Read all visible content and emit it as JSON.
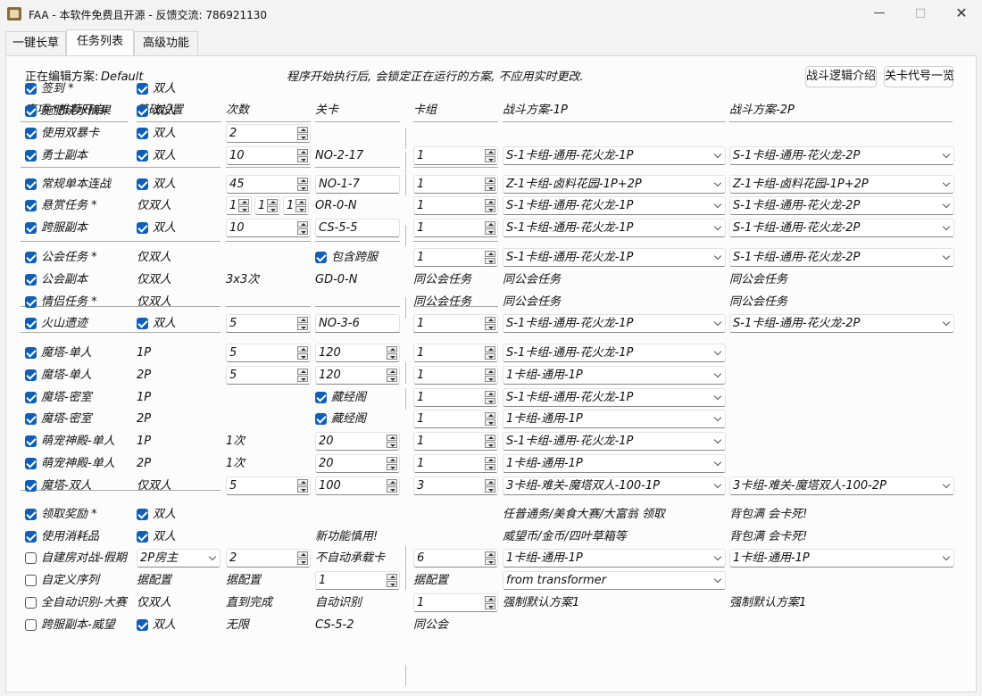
{
  "window": {
    "title": "FAA - 本软件免费且开源 - 反馈交流: 786921130"
  },
  "tabs": [
    "一键长草",
    "任务列表",
    "高级功能"
  ],
  "editing": {
    "label": "正在编辑方案:",
    "scheme": "Default",
    "notice": "程序开始执行后, 会锁定正在运行的方案, 不应用实时更改.",
    "btn_logic": "战斗逻辑介绍",
    "btn_codes": "关卡代号一览"
  },
  "columns": [
    "事项 *推荐开启",
    "基础设置",
    "次数",
    "关卡",
    "卡组",
    "战斗方案-1P",
    "战斗方案-2P"
  ],
  "rows": [
    {
      "name": "签到 *",
      "base": "双人"
    },
    {
      "name": "施肥浇水摘果",
      "base": "双人"
    },
    {
      "name": "使用双暴卡",
      "base": "双人",
      "count": "2"
    },
    {
      "name": "勇士副本",
      "base": "双人",
      "count": "10",
      "stage": "NO-2-17",
      "deck": "1",
      "p1": "S-1卡组-通用-花火龙-1P",
      "p2": "S-1卡组-通用-花火龙-2P"
    },
    {
      "name": "常规单本连战",
      "base": "双人",
      "count": "45",
      "stage": "NO-1-7",
      "deck": "1",
      "p1": "Z-1卡组-卤料花园-1P+2P",
      "p2": "Z-1卡组-卤料花园-1P+2P"
    },
    {
      "name": "悬赏任务 *",
      "base": "仅双人",
      "counts": [
        "1",
        "1",
        "1"
      ],
      "stage": "OR-0-N",
      "deck": "1",
      "p1": "S-1卡组-通用-花火龙-1P",
      "p2": "S-1卡组-通用-花火龙-2P"
    },
    {
      "name": "跨服副本",
      "base": "双人",
      "count": "10",
      "stage": "CS-5-5",
      "deck": "1",
      "p1": "S-1卡组-通用-花火龙-1P",
      "p2": "S-1卡组-通用-花火龙-2P"
    },
    {
      "name": "公会任务 *",
      "base": "仅双人",
      "stage": "包含跨服",
      "deck": "1",
      "p1": "S-1卡组-通用-花火龙-1P",
      "p2": "S-1卡组-通用-花火龙-2P"
    },
    {
      "name": "公会副本",
      "base": "仅双人",
      "count": "3x3次",
      "stage": "GD-0-N",
      "deck": "同公会任务",
      "p1": "同公会任务",
      "p2": "同公会任务"
    },
    {
      "name": "情侣任务 *",
      "base": "仅双人",
      "deck": "同公会任务",
      "p1": "同公会任务",
      "p2": "同公会任务"
    },
    {
      "name": "火山遗迹",
      "base": "双人",
      "count": "5",
      "stage": "NO-3-6",
      "deck": "1",
      "p1": "S-1卡组-通用-花火龙-1P",
      "p2": "S-1卡组-通用-花火龙-2P"
    },
    {
      "name": "魔塔-单人",
      "base": "1P",
      "count": "5",
      "stage": "120",
      "deck": "1",
      "p1": "S-1卡组-通用-花火龙-1P"
    },
    {
      "name": "魔塔-单人",
      "base": "2P",
      "count": "5",
      "stage": "120",
      "deck": "1",
      "p1": "1卡组-通用-1P"
    },
    {
      "name": "魔塔-密室",
      "base": "1P",
      "stage": "藏经阁",
      "deck": "1",
      "p1": "S-1卡组-通用-花火龙-1P"
    },
    {
      "name": "魔塔-密室",
      "base": "2P",
      "stage": "藏经阁",
      "deck": "1",
      "p1": "1卡组-通用-1P"
    },
    {
      "name": "萌宠神殿-单人",
      "base": "1P",
      "count": "1次",
      "stage": "20",
      "deck": "1",
      "p1": "S-1卡组-通用-花火龙-1P"
    },
    {
      "name": "萌宠神殿-单人",
      "base": "2P",
      "count": "1次",
      "stage": "20",
      "deck": "1",
      "p1": "1卡组-通用-1P"
    },
    {
      "name": "魔塔-双人",
      "base": "仅双人",
      "count": "5",
      "stage": "100",
      "deck": "3",
      "p1": "3卡组-难关-魔塔双人-100-1P",
      "p2": "3卡组-难关-魔塔双人-100-2P"
    },
    {
      "name": "领取奖励 *",
      "base": "双人",
      "p1": "任普通务/美食大赛/大富翁 领取",
      "p2": "背包满 会卡死!"
    },
    {
      "name": "使用消耗品",
      "base": "双人",
      "stage": "新功能慎用!",
      "p1": "威望币/金币/四叶草箱等",
      "p2": "背包满 会卡死!"
    },
    {
      "name": "自建房对战-假期",
      "base": "2P房主",
      "count": "2",
      "stage": "不自动承载卡",
      "deck": "6",
      "p1": "1卡组-通用-1P",
      "p2": "1卡组-通用-1P"
    },
    {
      "name": "自定义序列",
      "base": "据配置",
      "count": "据配置",
      "stage": "1",
      "deck": "据配置",
      "p1": "from  transformer"
    },
    {
      "name": "全自动识别-大赛",
      "base": "仅双人",
      "count": "直到完成",
      "stage": "自动识别",
      "deck": "1",
      "p1": "强制默认方案1",
      "p2": "强制默认方案1"
    },
    {
      "name": "跨服副本-威望",
      "base": "双人",
      "count": "无限",
      "stage": "CS-5-2",
      "deck": "同公会"
    }
  ]
}
